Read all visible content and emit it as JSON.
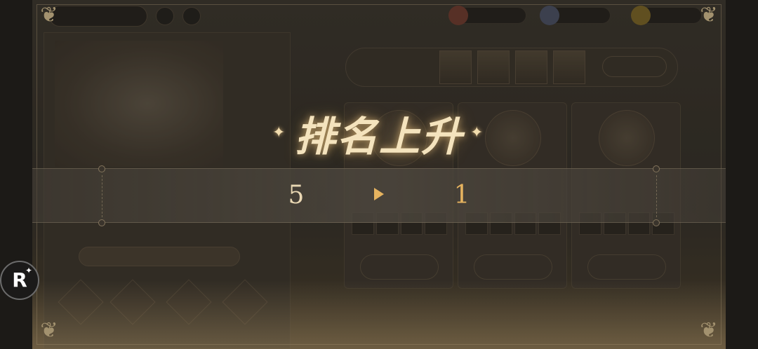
{
  "popup": {
    "headline": "排名上升",
    "old_rank": "5",
    "new_rank": "1",
    "sparkle": "✦"
  },
  "overlay_button": {
    "label": "R",
    "star": "✦"
  },
  "colors": {
    "headline": "#f4e3bd",
    "old_rank": "#ead8b4",
    "new_rank": "#e6b35f",
    "arrow": "#e6b35f"
  },
  "icons": {
    "arrow": "play-arrow-icon",
    "corner": "ornament-icon"
  }
}
